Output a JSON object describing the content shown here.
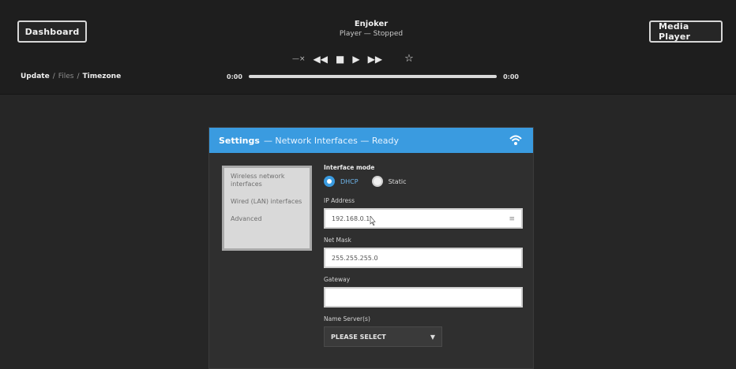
{
  "header": {
    "dashboard_button": "Dashboard",
    "media_player_button": "Media Player",
    "now_playing": {
      "title": "Enjoker",
      "subtitle": "Player — Stopped"
    },
    "controls": {
      "volume_icon": "volume-icon",
      "prev_icon": "previous-icon",
      "stop_icon": "stop-icon",
      "play_icon": "play-icon",
      "next_icon": "next-icon",
      "favorite_icon": "star-icon"
    },
    "breadcrumb": {
      "first": "Update",
      "second": "Files",
      "third": "Timezone"
    },
    "progress": {
      "time_elapsed": "0:00",
      "time_total": "0:00",
      "value_percent": 100
    }
  },
  "dialog": {
    "title_strong": "Settings",
    "title_rest": "— Network Interfaces — Ready",
    "header_icon": "wifi-icon",
    "side_menu": [
      "Wireless network interfaces",
      "Wired (LAN) interfaces",
      "Advanced"
    ],
    "form": {
      "interface_mode_label": "Interface mode",
      "radio_dhcp": "DHCP",
      "radio_static": "Static",
      "ip_label": "IP Address",
      "ip_value": "192.168.0.1",
      "netmask_label": "Net Mask",
      "netmask_value": "255.255.255.0",
      "gateway_label": "Gateway",
      "gateway_value": "",
      "nameserver_label": "Name Server(s)",
      "select_value": "PLEASE SELECT"
    }
  },
  "colors": {
    "accent": "#3a9be0",
    "background": "#262626",
    "top_bar": "#1e1e1e"
  }
}
